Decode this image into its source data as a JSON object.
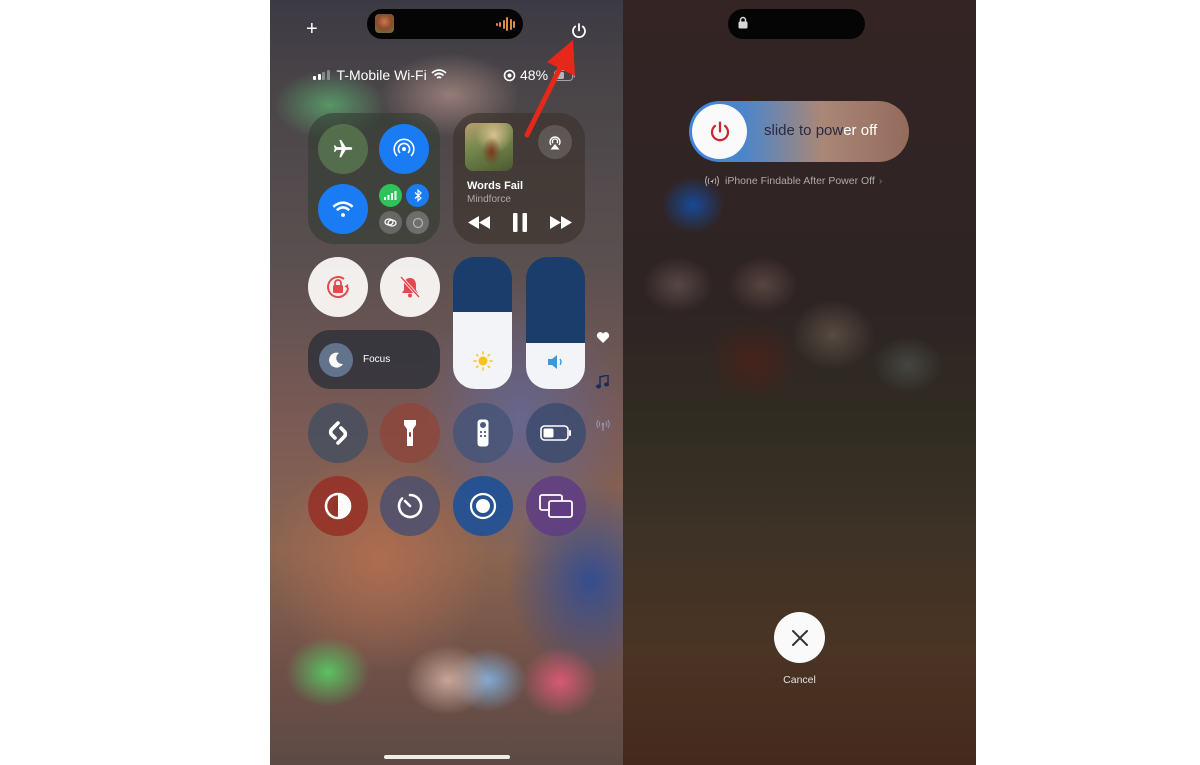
{
  "control_center": {
    "add_button_label": "+",
    "carrier": "T-Mobile Wi-Fi",
    "battery_percent": "48%",
    "signal_bars_active": 2,
    "signal_bars_total": 4,
    "dynamic_island": {
      "now_playing_art": "album-art",
      "activity_icon": "waveform-icon"
    },
    "connectivity": {
      "airplane_mode": {
        "icon": "airplane-icon",
        "on": false
      },
      "airdrop": {
        "icon": "airdrop-icon",
        "on": true
      },
      "wifi": {
        "icon": "wifi-icon",
        "on": true
      },
      "cellular": {
        "icon": "cellular-icon",
        "on": true
      },
      "bluetooth": {
        "icon": "bluetooth-icon",
        "on": true
      },
      "personal_hotspot": {
        "icon": "link-icon",
        "on": false
      },
      "vpn": {
        "icon": "vpn-icon",
        "on": false
      }
    },
    "now_playing": {
      "title": "Words Fail",
      "artist": "Mindforce"
    },
    "focus_label": "Focus",
    "brightness_level": 0.58,
    "volume_level": 0.35,
    "side_icons": [
      "heart-icon",
      "music-note-icon",
      "antenna-icon"
    ],
    "tiles": [
      {
        "name": "shazam",
        "icon": "shazam-icon"
      },
      {
        "name": "flashlight",
        "icon": "flashlight-icon"
      },
      {
        "name": "apple-tv-remote",
        "icon": "remote-icon"
      },
      {
        "name": "low-power-mode",
        "icon": "battery-icon"
      },
      {
        "name": "dark-mode",
        "icon": "dark-mode-icon"
      },
      {
        "name": "timer",
        "icon": "timer-icon"
      },
      {
        "name": "screen-recording",
        "icon": "record-icon"
      },
      {
        "name": "screen-mirroring",
        "icon": "screen-mirror-icon"
      }
    ],
    "annotation": {
      "type": "arrow",
      "color": "#e8271b",
      "points_to": "power-button"
    }
  },
  "power_off": {
    "slider_label_dark": "slide to pow",
    "slider_label_light": "er off",
    "findable_text": "iPhone Findable After Power Off",
    "cancel_label": "Cancel",
    "accent_color": "#c8282e"
  }
}
